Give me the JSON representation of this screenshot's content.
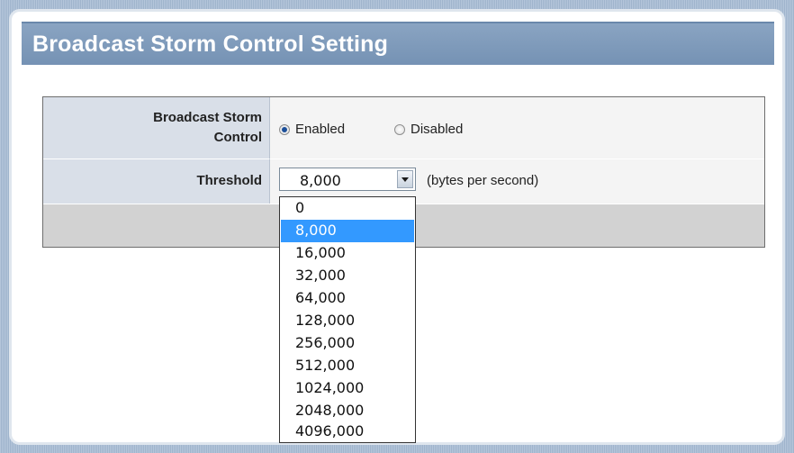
{
  "title": "Broadcast Storm Control Setting",
  "storm_control": {
    "label_line1": "Broadcast Storm",
    "label_line2": "Control",
    "enabled_label": "Enabled",
    "disabled_label": "Disabled",
    "selected": "Enabled"
  },
  "threshold": {
    "label": "Threshold",
    "value": "8,000",
    "unit": "(bytes per second)",
    "options": [
      "0",
      "8,000",
      "16,000",
      "32,000",
      "64,000",
      "128,000",
      "256,000",
      "512,000",
      "1024,000",
      "2048,000",
      "4096,000"
    ],
    "selected_option": "8,000"
  },
  "icons": {
    "dropdown": "chevron-down-icon"
  },
  "colors": {
    "header_bg": "#7f9bbb",
    "label_cell_bg": "#d9dfe8",
    "selected_option_bg": "#3399ff",
    "radio_dot": "#1c4f99"
  }
}
